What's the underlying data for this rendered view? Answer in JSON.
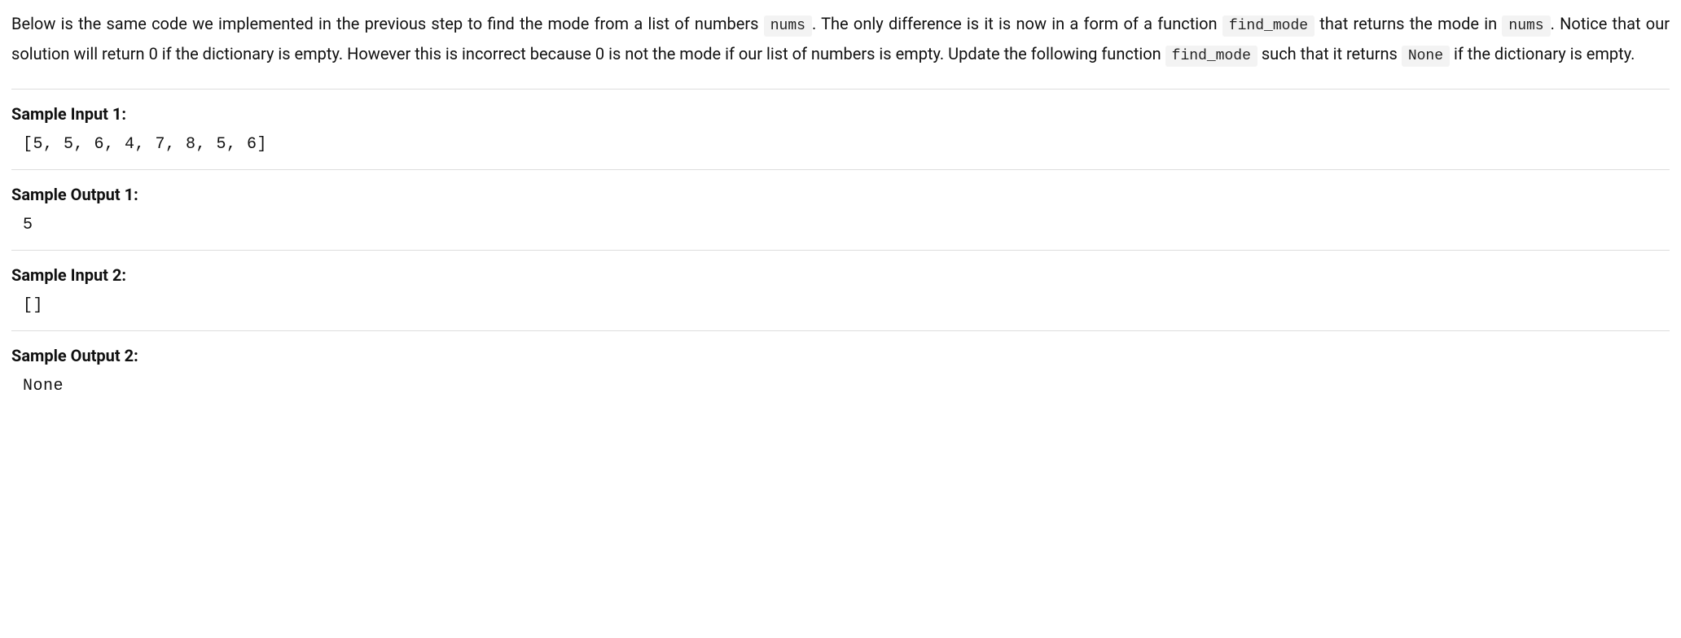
{
  "description": {
    "part1": "Below is the same code we implemented in the previous step to find the mode from a list of numbers ",
    "code1": "nums",
    "part2": ". The only difference is it is now in a form of a function ",
    "code2": "find_mode",
    "part3": " that returns the mode in ",
    "code3": "nums",
    "part4": ". Notice that our solution will return 0 if the dictionary is empty. However this is incorrect because 0 is not the mode if our list of numbers is empty. Update the following function ",
    "code4": "find_mode",
    "part5": " such that it returns ",
    "code5": "None",
    "part6": " if the dictionary is empty."
  },
  "samples": [
    {
      "input_label": "Sample Input 1:",
      "input_value": "[5, 5, 6, 4, 7, 8, 5, 6]",
      "output_label": "Sample Output 1:",
      "output_value": "5"
    },
    {
      "input_label": "Sample Input 2:",
      "input_value": "[]",
      "output_label": "Sample Output 2:",
      "output_value": "None"
    }
  ]
}
